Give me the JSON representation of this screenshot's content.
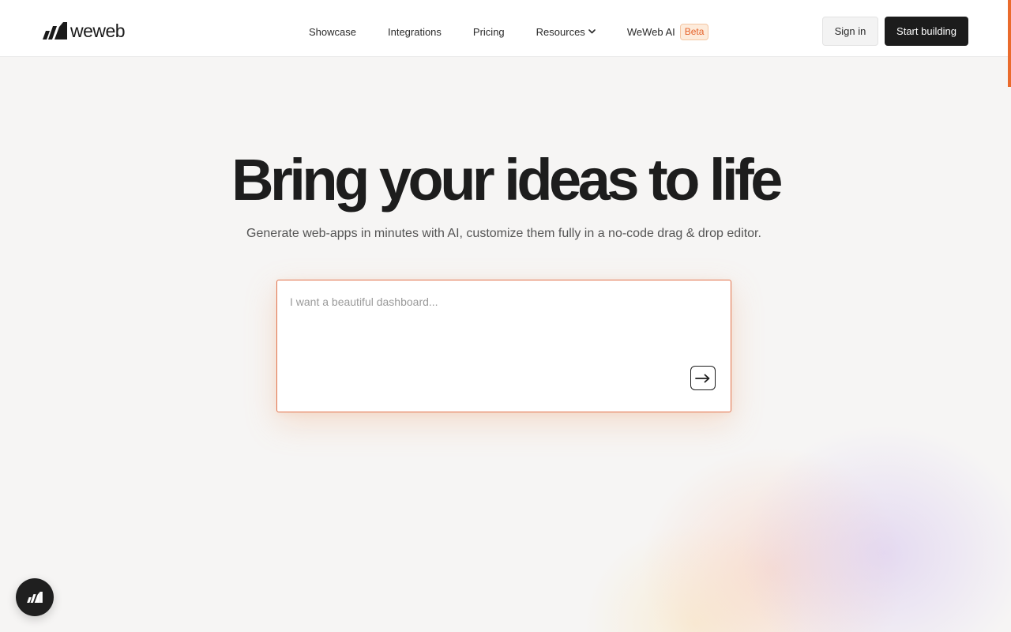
{
  "header": {
    "brand": "weweb",
    "nav": {
      "showcase": "Showcase",
      "integrations": "Integrations",
      "pricing": "Pricing",
      "resources": "Resources",
      "weweb_ai": "WeWeb AI",
      "beta_badge": "Beta"
    },
    "sign_in": "Sign in",
    "start_building": "Start building"
  },
  "hero": {
    "title": "Bring your ideas to life",
    "subtitle": "Generate web-apps in minutes with AI, customize them fully in a no-code drag & drop editor."
  },
  "prompt": {
    "placeholder": "I want a beautiful dashboard...",
    "value": ""
  },
  "icons": {
    "logo": "weweb-logo-icon",
    "dropdown": "chevron-down-icon",
    "submit": "arrow-right-icon",
    "chat": "weweb-chat-icon"
  },
  "colors": {
    "accent": "#ea6b2c",
    "dark": "#1c1c1c",
    "beta_bg": "#fdebdb"
  }
}
